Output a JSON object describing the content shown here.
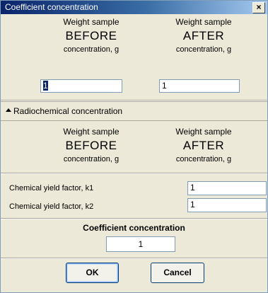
{
  "window": {
    "title": "Coefficient concentration",
    "close_label": "×"
  },
  "top_section": {
    "before": {
      "line1": "Weight sample",
      "line2": "BEFORE",
      "line3": "concentration, g",
      "value": "1"
    },
    "after": {
      "line1": "Weight sample",
      "line2": "AFTER",
      "line3": "concentration, g",
      "value": "1"
    }
  },
  "radiochemical": {
    "header": "Radiochemical concentration",
    "before": {
      "line1": "Weight sample",
      "line2": "BEFORE",
      "line3": "concentration, g"
    },
    "after": {
      "line1": "Weight sample",
      "line2": "AFTER",
      "line3": "concentration, g"
    },
    "k1_label": "Chemical yield factor, k1",
    "k1_value": "1",
    "k2_label": "Chemical yield factor, k2",
    "k2_value": "1"
  },
  "coefficient": {
    "title": "Coefficient concentration",
    "value": "1"
  },
  "buttons": {
    "ok": "OK",
    "cancel": "Cancel"
  }
}
